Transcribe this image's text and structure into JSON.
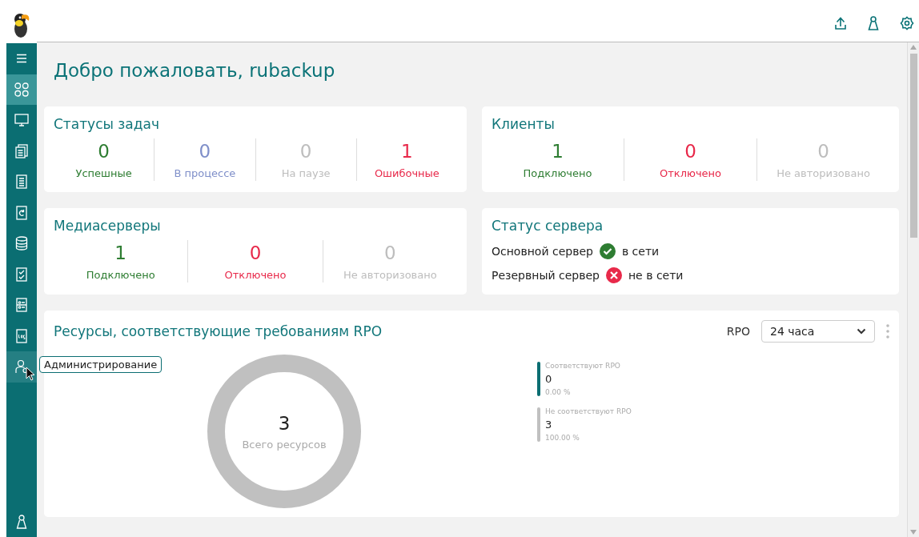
{
  "sidebar": {
    "items": [
      {
        "kind": "menu",
        "selected": false
      },
      {
        "kind": "grid",
        "selected": true
      },
      {
        "kind": "monitor",
        "selected": false
      },
      {
        "kind": "copies",
        "selected": false
      },
      {
        "kind": "document",
        "selected": false
      },
      {
        "kind": "refresh",
        "selected": false
      },
      {
        "kind": "database",
        "selected": false
      },
      {
        "kind": "checklist",
        "selected": false
      },
      {
        "kind": "list",
        "selected": false
      },
      {
        "kind": "log",
        "selected": false
      },
      {
        "kind": "admin",
        "selected": false,
        "tooltip": "Администрирование"
      }
    ],
    "bottom": {
      "kind": "user"
    }
  },
  "header": {
    "actions": [
      {
        "kind": "upload"
      },
      {
        "kind": "user"
      },
      {
        "kind": "settings"
      }
    ]
  },
  "title": "Добро пожаловать, rubackup",
  "cards": [
    {
      "title": "Статусы задач",
      "stats": [
        {
          "value": "0",
          "label": "Успешные",
          "color": "#2e7d32"
        },
        {
          "value": "0",
          "label": "В процессе",
          "color": "#7f8fc9"
        },
        {
          "value": "0",
          "label": "На паузе",
          "color": "#bdbdbd"
        },
        {
          "value": "1",
          "label": "Ошибочные",
          "color": "#e8294a"
        }
      ]
    },
    {
      "title": "Клиенты",
      "stats": [
        {
          "value": "1",
          "label": "Подключено",
          "color": "#2e7d32"
        },
        {
          "value": "0",
          "label": "Отключено",
          "color": "#e8294a"
        },
        {
          "value": "0",
          "label": "Не авторизовано",
          "color": "#bdbdbd"
        }
      ]
    },
    {
      "title": "Медиасерверы",
      "stats": [
        {
          "value": "1",
          "label": "Подключено",
          "color": "#2e7d32"
        },
        {
          "value": "0",
          "label": "Отключено",
          "color": "#e8294a"
        },
        {
          "value": "0",
          "label": "Не авторизовано",
          "color": "#bdbdbd"
        }
      ]
    }
  ],
  "server_status": {
    "title": "Статус сервера",
    "servers": [
      {
        "name": "Основной сервер",
        "on": true,
        "status": "в сети"
      },
      {
        "name": "Резервный сервер",
        "on": false,
        "status": "не в сети"
      }
    ]
  },
  "rpo": {
    "title": "Ресурсы, соответствующие требованиям RPO",
    "filter_label": "RPO",
    "filter_value": "24 часа",
    "total": "3",
    "total_label": "Всего ресурсов",
    "legend": [
      {
        "label": "Соответствуют RPO",
        "value": "0",
        "percent": "0.00 %",
        "color": "#0b6e72"
      },
      {
        "label": "Не соответствуют RPO",
        "value": "3",
        "percent": "100.00 %",
        "color": "#c0c0c0"
      }
    ]
  }
}
